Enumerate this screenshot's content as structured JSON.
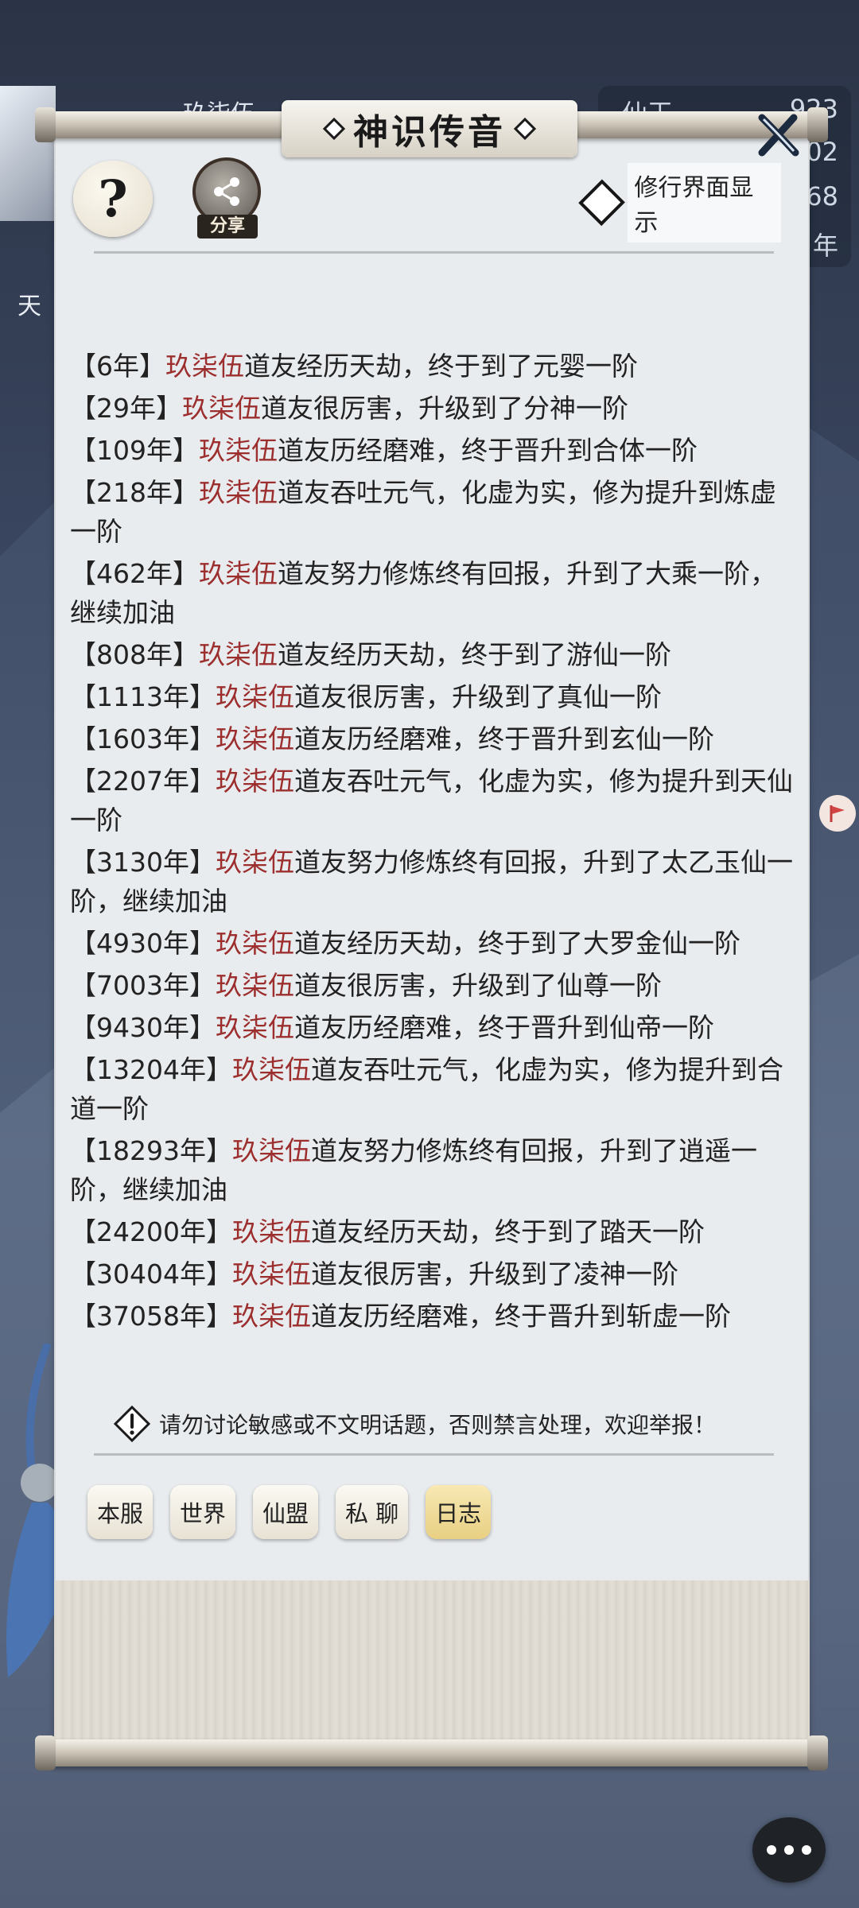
{
  "background": {
    "player_name": "玖柒伍",
    "resources": [
      {
        "label": "仙玉",
        "value": "923"
      },
      {
        "label": "",
        "value": "02"
      },
      {
        "label": "",
        "value": "68"
      },
      {
        "label": "",
        "value": "年"
      }
    ],
    "left_glyph": "天"
  },
  "dialog": {
    "title": "神识传音",
    "help_label": "?",
    "share_label": "分享",
    "display_toggle_label": "修行界面显示"
  },
  "log_entries": [
    {
      "year": "【6年】",
      "name": "玖柒伍",
      "text": "道友经历天劫，终于到了元婴一阶"
    },
    {
      "year": "【29年】",
      "name": "玖柒伍",
      "text": "道友很厉害，升级到了分神一阶"
    },
    {
      "year": "【109年】",
      "name": "玖柒伍",
      "text": "道友历经磨难，终于晋升到合体一阶"
    },
    {
      "year": "【218年】",
      "name": "玖柒伍",
      "text": "道友吞吐元气，化虚为实，修为提升到炼虚一阶"
    },
    {
      "year": "【462年】",
      "name": "玖柒伍",
      "text": "道友努力修炼终有回报，升到了大乘一阶，继续加油"
    },
    {
      "year": "【808年】",
      "name": "玖柒伍",
      "text": "道友经历天劫，终于到了游仙一阶"
    },
    {
      "year": "【1113年】",
      "name": "玖柒伍",
      "text": "道友很厉害，升级到了真仙一阶"
    },
    {
      "year": "【1603年】",
      "name": "玖柒伍",
      "text": "道友历经磨难，终于晋升到玄仙一阶"
    },
    {
      "year": "【2207年】",
      "name": "玖柒伍",
      "text": "道友吞吐元气，化虚为实，修为提升到天仙一阶"
    },
    {
      "year": "【3130年】",
      "name": "玖柒伍",
      "text": "道友努力修炼终有回报，升到了太乙玉仙一阶，继续加油"
    },
    {
      "year": "【4930年】",
      "name": "玖柒伍",
      "text": "道友经历天劫，终于到了大罗金仙一阶"
    },
    {
      "year": "【7003年】",
      "name": "玖柒伍",
      "text": "道友很厉害，升级到了仙尊一阶"
    },
    {
      "year": "【9430年】",
      "name": "玖柒伍",
      "text": "道友历经磨难，终于晋升到仙帝一阶"
    },
    {
      "year": "【13204年】",
      "name": "玖柒伍",
      "text": "道友吞吐元气，化虚为实，修为提升到合道一阶"
    },
    {
      "year": "【18293年】",
      "name": "玖柒伍",
      "text": "道友努力修炼终有回报，升到了逍遥一阶，继续加油"
    },
    {
      "year": "【24200年】",
      "name": "玖柒伍",
      "text": "道友经历天劫，终于到了踏天一阶"
    },
    {
      "year": "【30404年】",
      "name": "玖柒伍",
      "text": "道友很厉害，升级到了凌神一阶"
    },
    {
      "year": "【37058年】",
      "name": "玖柒伍",
      "text": "道友历经磨难，终于晋升到斩虚一阶"
    }
  ],
  "warning": "请勿讨论敏感或不文明话题，否则禁言处理，欢迎举报！",
  "tabs": [
    {
      "label": "本服",
      "active": false
    },
    {
      "label": "世界",
      "active": false
    },
    {
      "label": "仙盟",
      "active": false
    },
    {
      "label": "私 聊",
      "active": false
    },
    {
      "label": "日志",
      "active": true
    }
  ],
  "colors": {
    "player_name": "#9c2e2e",
    "active_tab": "#e8cf82",
    "paper": "#e9ecef"
  }
}
